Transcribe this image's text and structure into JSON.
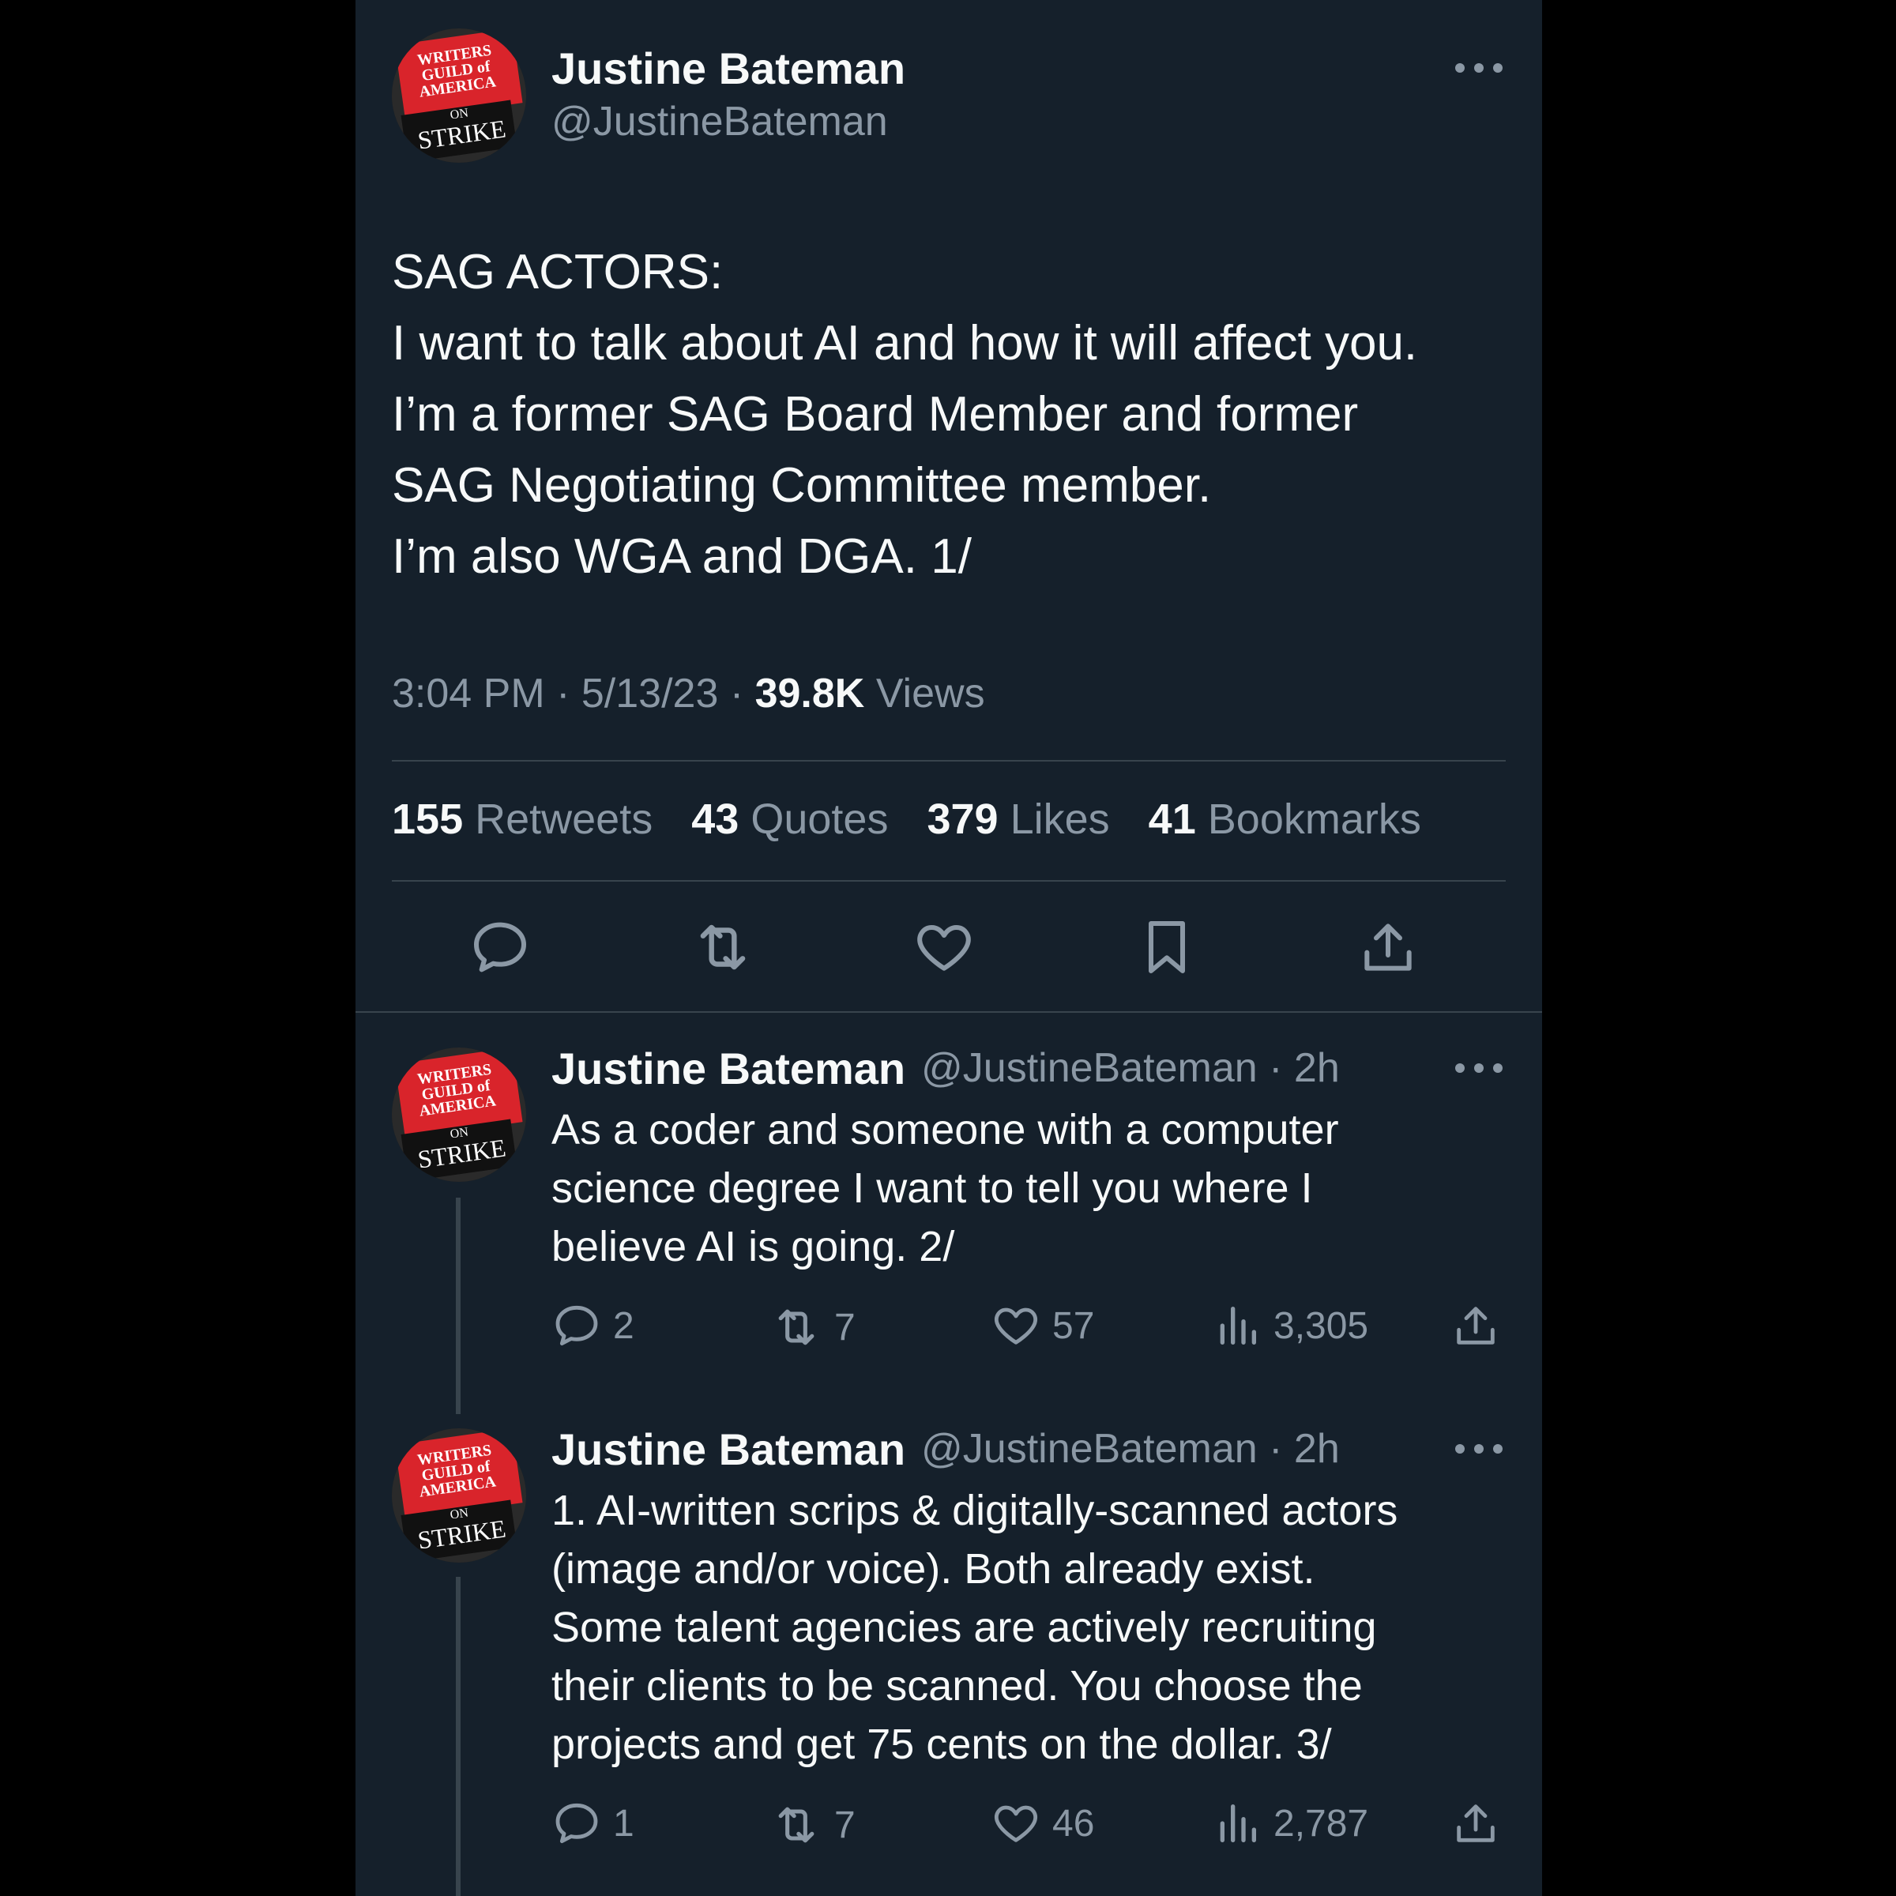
{
  "author": {
    "name": "Justine Bateman",
    "handle": "@JustineBateman"
  },
  "avatar": {
    "line1": "WRITERS",
    "line2": "GUILD of",
    "line3": "AMERICA",
    "line4": "ON",
    "line5": "STRIKE"
  },
  "main_tweet": {
    "lines": [
      "SAG ACTORS:",
      "I want to talk about AI and how it will affect you.",
      "I’m a former SAG Board Member and former",
      "SAG Negotiating Committee member.",
      "I’m also WGA and DGA. 1/"
    ],
    "time": "3:04 PM",
    "date": "5/13/23",
    "views_count": "39.8K",
    "views_label": "Views",
    "stats": {
      "retweets_count": "155",
      "retweets_label": "Retweets",
      "quotes_count": "43",
      "quotes_label": "Quotes",
      "likes_count": "379",
      "likes_label": "Likes",
      "bookmarks_count": "41",
      "bookmarks_label": "Bookmarks"
    }
  },
  "replies": [
    {
      "name": "Justine Bateman",
      "handle": "@JustineBateman",
      "age": "2h",
      "lines": [
        "As a coder and someone with a computer",
        "science degree I want to tell you where I",
        "believe AI is going. 2/"
      ],
      "replies": "2",
      "retweets": "7",
      "likes": "57",
      "views": "3,305"
    },
    {
      "name": "Justine Bateman",
      "handle": "@JustineBateman",
      "age": "2h",
      "lines": [
        "1. AI-written scrips & digitally-scanned actors",
        "(image and/or voice). Both already exist.",
        "Some talent agencies are actively recruiting",
        "their clients to be scanned. You choose the",
        "projects and get 75 cents on the dollar. 3/"
      ],
      "replies": "1",
      "retweets": "7",
      "likes": "46",
      "views": "2,787"
    }
  ],
  "colors": {
    "background": "#15202b",
    "muted": "#8b98a5",
    "text": "#f7f9f9",
    "divider": "#38444d"
  }
}
